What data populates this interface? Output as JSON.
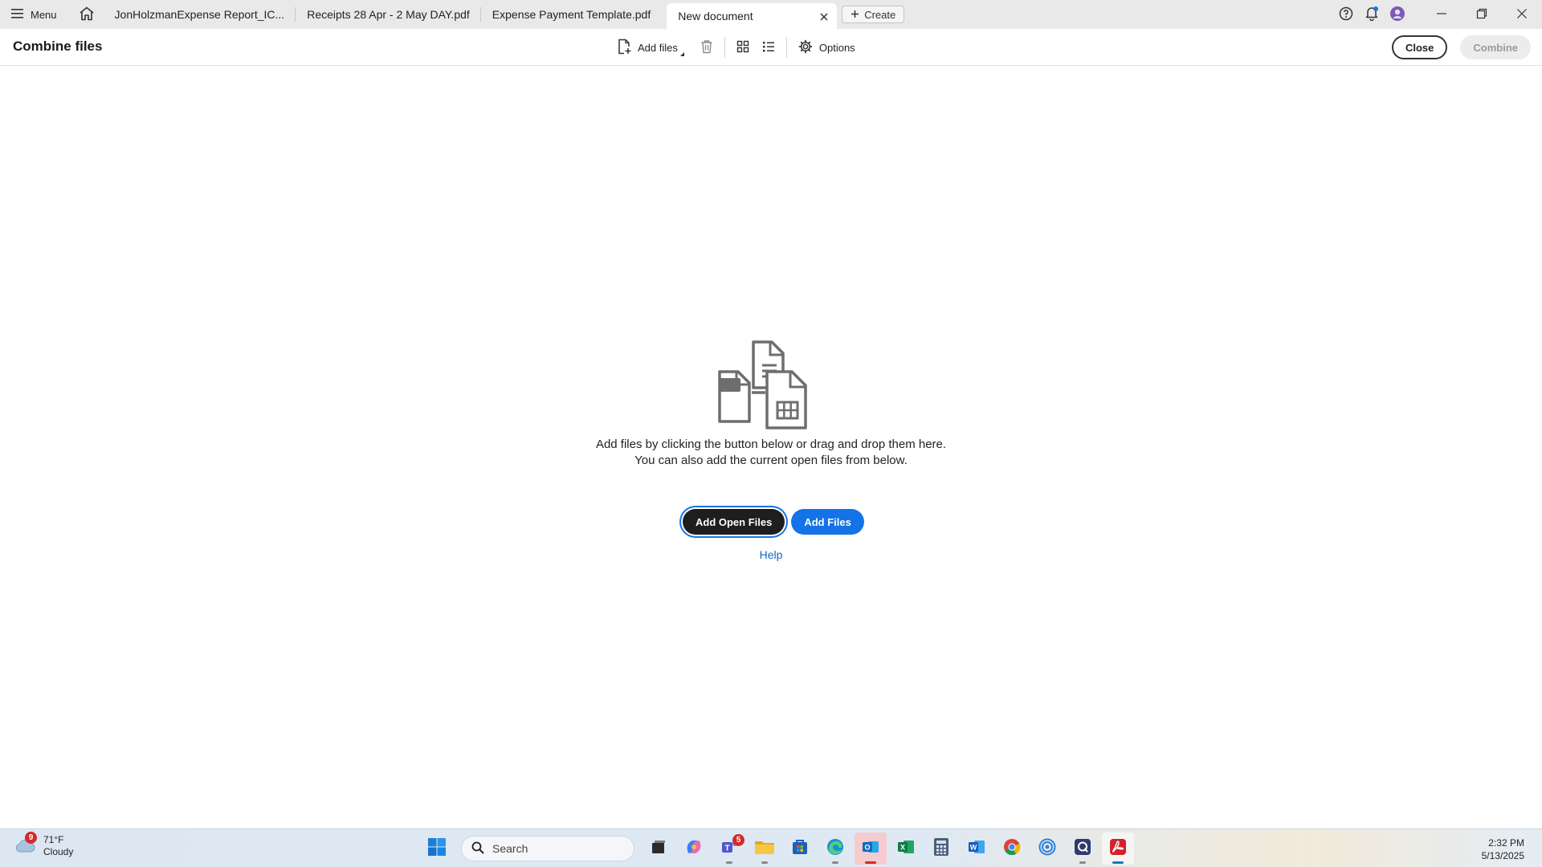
{
  "tabbar": {
    "menu_label": "Menu",
    "tabs": [
      {
        "label": "JonHolzmanExpense Report_IC..."
      },
      {
        "label": "Receipts 28 Apr - 2 May DAY.pdf"
      },
      {
        "label": "Expense Payment Template.pdf"
      },
      {
        "label": "New document",
        "active": true
      }
    ],
    "create_label": "Create"
  },
  "toolbar": {
    "title": "Combine files",
    "add_files_label": "Add files",
    "options_label": "Options",
    "close_label": "Close",
    "combine_label": "Combine"
  },
  "main": {
    "message_line1": "Add files by clicking the button below or drag and drop them here.",
    "message_line2": "You can also add the current open files from below.",
    "add_open_files_label": "Add Open Files",
    "add_files_button_label": "Add Files",
    "help_label": "Help"
  },
  "taskbar": {
    "weather_badge": "9",
    "temperature": "71°F",
    "condition": "Cloudy",
    "search_placeholder": "Search",
    "teams_badge": "5",
    "time": "2:32 PM",
    "date": "5/13/2025"
  },
  "colors": {
    "accent_blue": "#1473e6",
    "dark_button": "#1e1e1e",
    "link_blue": "#1464c8",
    "acrobat_red": "#d4212a"
  },
  "icons": {
    "menu": "hamburger-icon",
    "home": "home-icon",
    "help": "help-circle-icon",
    "notifications": "bell-icon",
    "trash": "trash-icon",
    "grid_view": "grid-view-icon",
    "list_view": "list-view-icon",
    "options": "gear-icon"
  }
}
